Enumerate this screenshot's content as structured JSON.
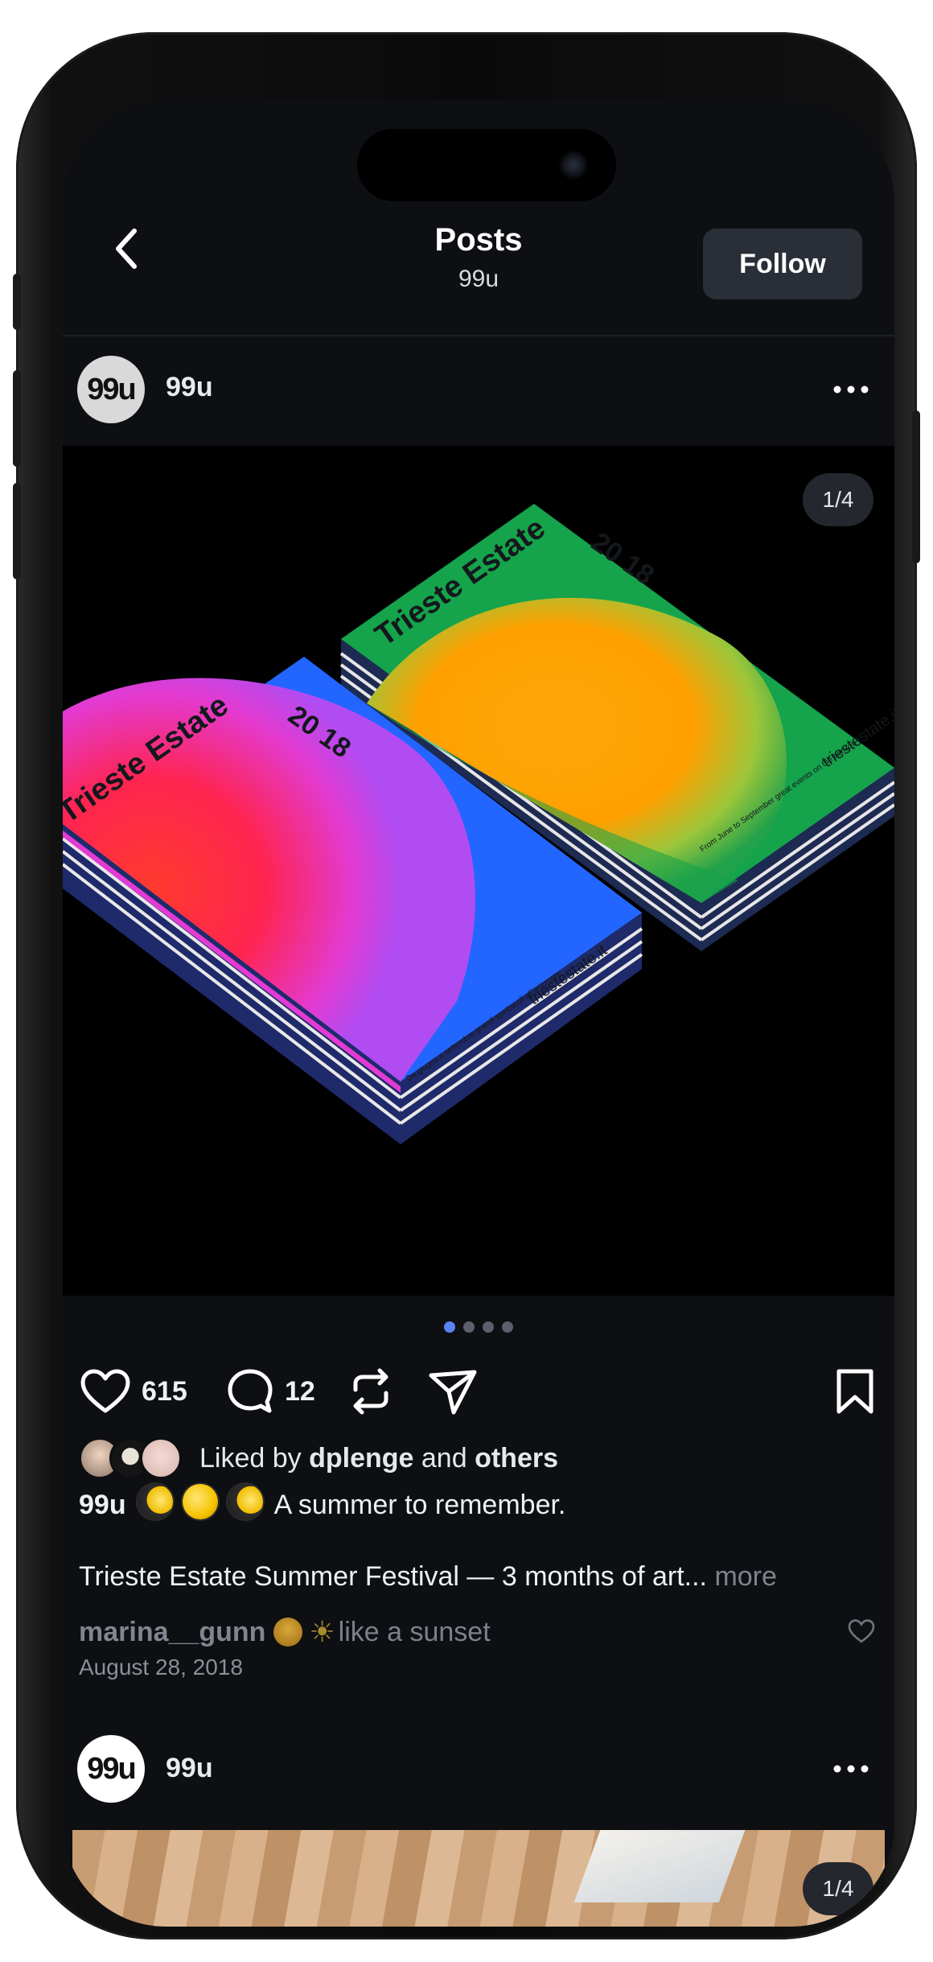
{
  "header": {
    "title": "Posts",
    "subtitle": "99u",
    "follow_label": "Follow"
  },
  "post": {
    "avatar_text": "99u",
    "username": "99u",
    "image_counter": "1/4",
    "carousel": {
      "count": 4,
      "active": 1
    },
    "image": {
      "left_book": {
        "title": "Trieste Estate",
        "year": "20 18",
        "url": "triestestate.it",
        "blurb": "Da giugno a settembre grandi spettacoli all'orizzonte",
        "colors": [
          "#1f5bff",
          "#ff2a3c",
          "#e838c9"
        ]
      },
      "right_book": {
        "title": "Trieste Estate",
        "year": "20 18",
        "url": "triestestate.it",
        "blurb": "From June to September great events on the horizon",
        "colors": [
          "#12a34a",
          "#ff9d0a"
        ]
      }
    },
    "likes": "615",
    "comments_count": "12",
    "liked_by": {
      "prefix": "Liked by",
      "user": "dplenge",
      "and": "and",
      "others": "others"
    },
    "caption": {
      "username": "99u",
      "text": "A summer to remember."
    },
    "description": {
      "text": "Trieste Estate Summer Festival — 3 months of art...",
      "more": "more"
    },
    "comment": {
      "username": "marina__gunn",
      "text": "like a sunset"
    },
    "date": "August 28, 2018"
  },
  "next_post": {
    "avatar_text": "99u",
    "username": "99u",
    "image_counter": "1/4"
  },
  "colors": {
    "background": "#0d0f12",
    "accent": "#5b82f2",
    "follow_bg": "#2a2e36"
  }
}
